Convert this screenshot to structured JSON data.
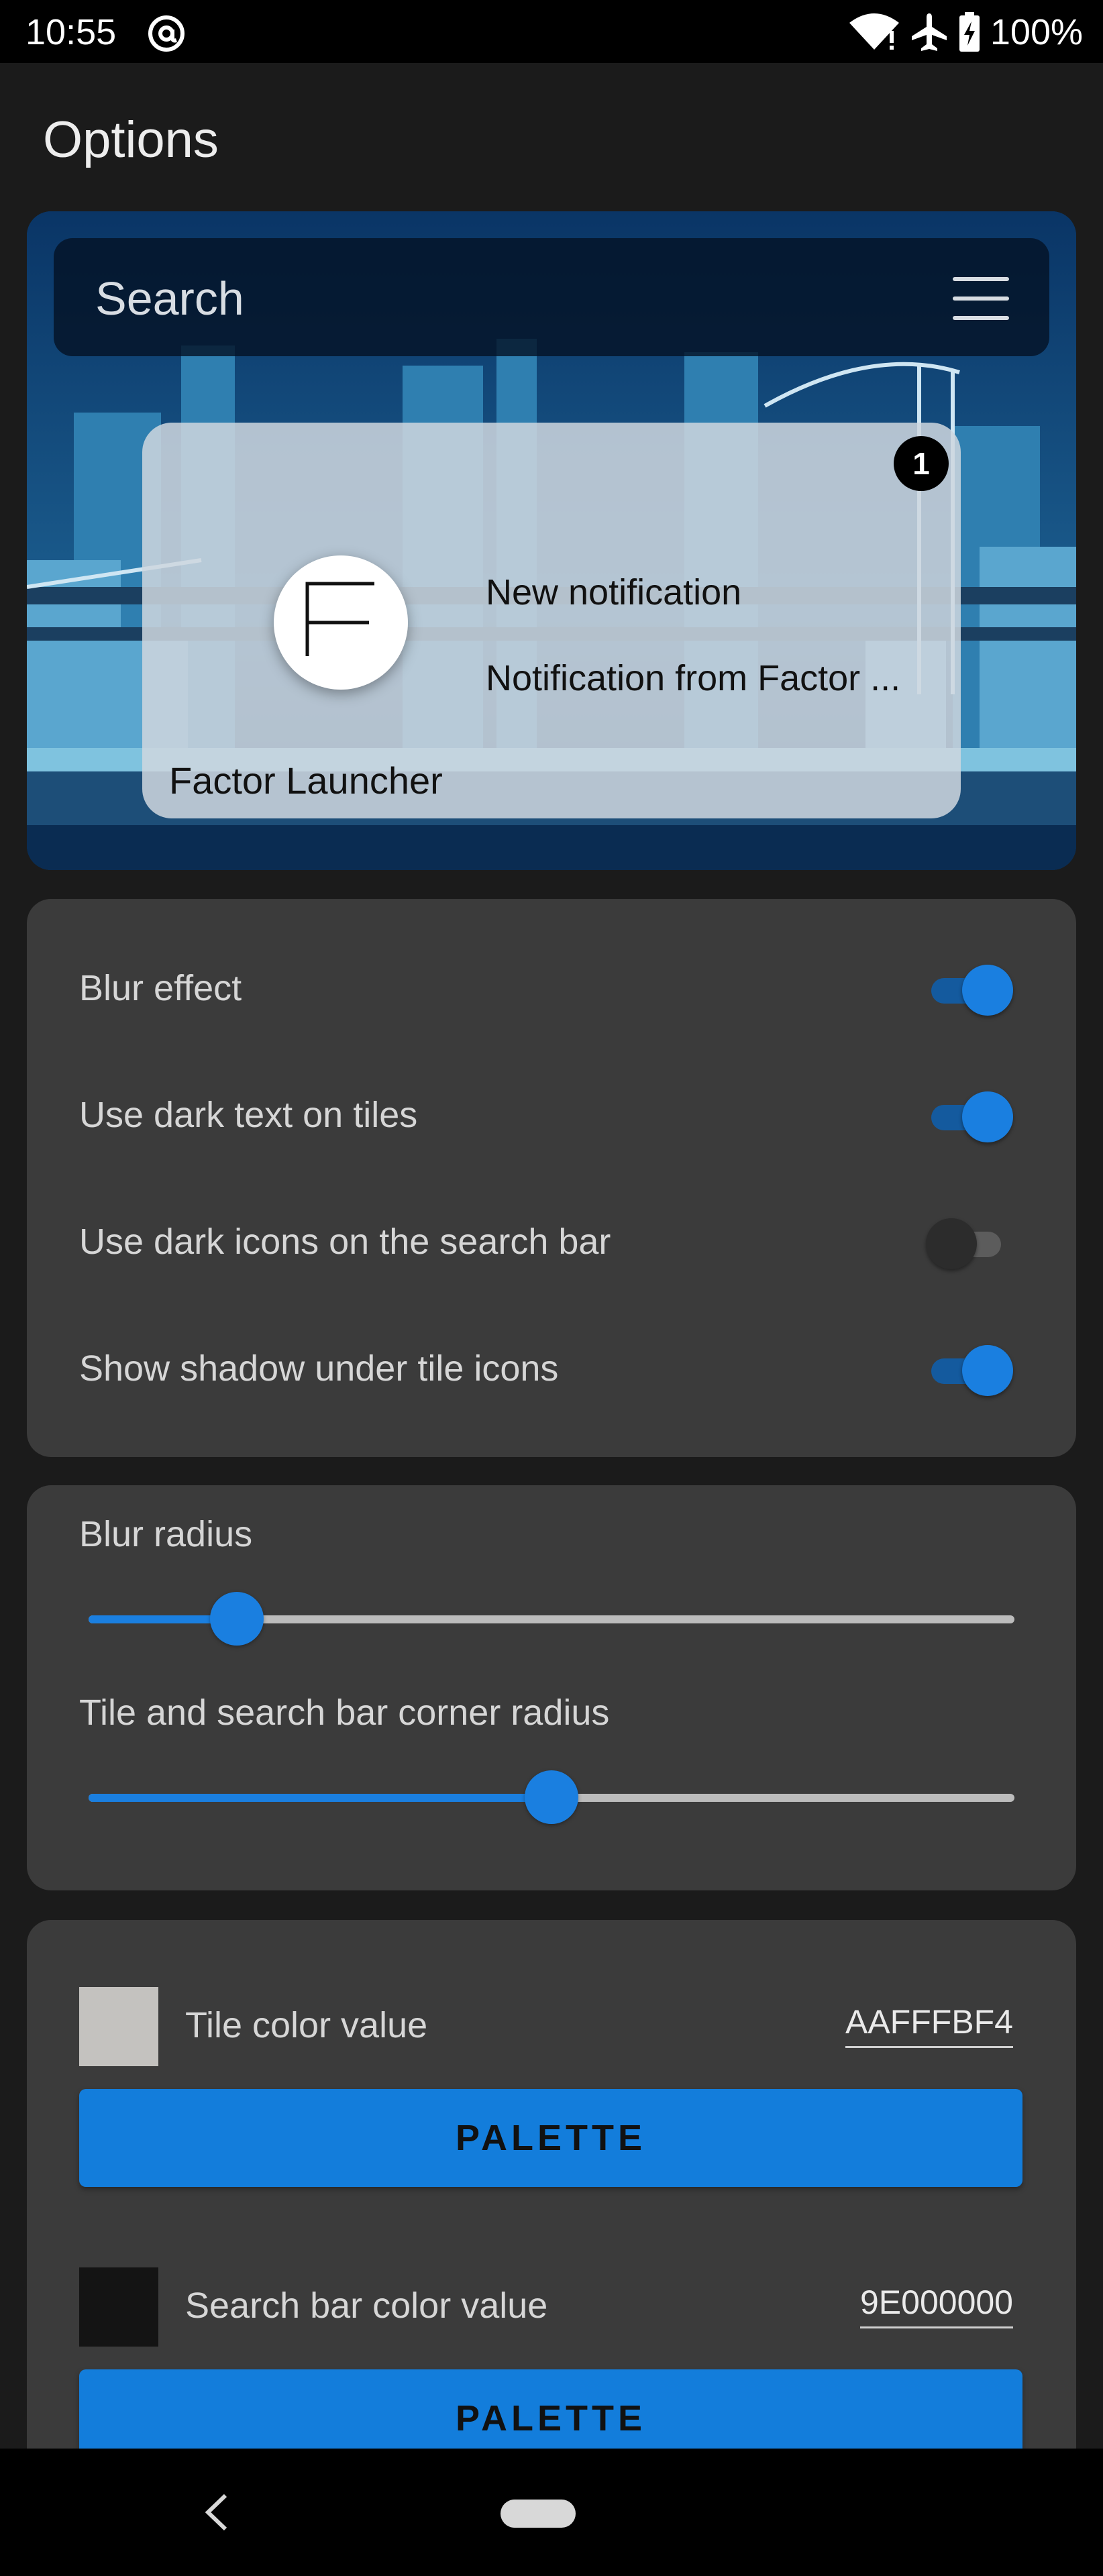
{
  "status_bar": {
    "time": "10:55",
    "battery_percent": "100%",
    "icons": [
      "at-sign-icon",
      "wifi-icon",
      "airplane-mode-icon",
      "battery-charging-icon"
    ]
  },
  "app_bar": {
    "title": "Options"
  },
  "preview": {
    "search_placeholder": "Search",
    "menu_icon": "hamburger-menu-icon",
    "notification": {
      "title": "New notification",
      "body": "Notification from Factor ...",
      "app_name": "Factor Launcher",
      "avatar_letter": "F",
      "badge_count": "1"
    }
  },
  "toggles": [
    {
      "label": "Blur effect",
      "on": true
    },
    {
      "label": "Use dark text on tiles",
      "on": true
    },
    {
      "label": "Use dark icons on the search bar",
      "on": false
    },
    {
      "label": "Show shadow under tile icons",
      "on": true
    }
  ],
  "sliders": [
    {
      "label": "Blur radius",
      "value_fraction": 0.16
    },
    {
      "label": "Tile and search bar corner radius",
      "value_fraction": 0.5
    }
  ],
  "colors": [
    {
      "label": "Tile color value",
      "hex": "AAFFFBF4",
      "swatch_color": "#c4c2bf",
      "button_label": "PALETTE"
    },
    {
      "label": "Search bar color value",
      "hex": "9E000000",
      "swatch_color": "#141414",
      "button_label": "PALETTE"
    }
  ],
  "theme": {
    "accent": "#1a7fe0",
    "card_background": "#3b3b3b",
    "page_background": "#1b1b1b"
  }
}
